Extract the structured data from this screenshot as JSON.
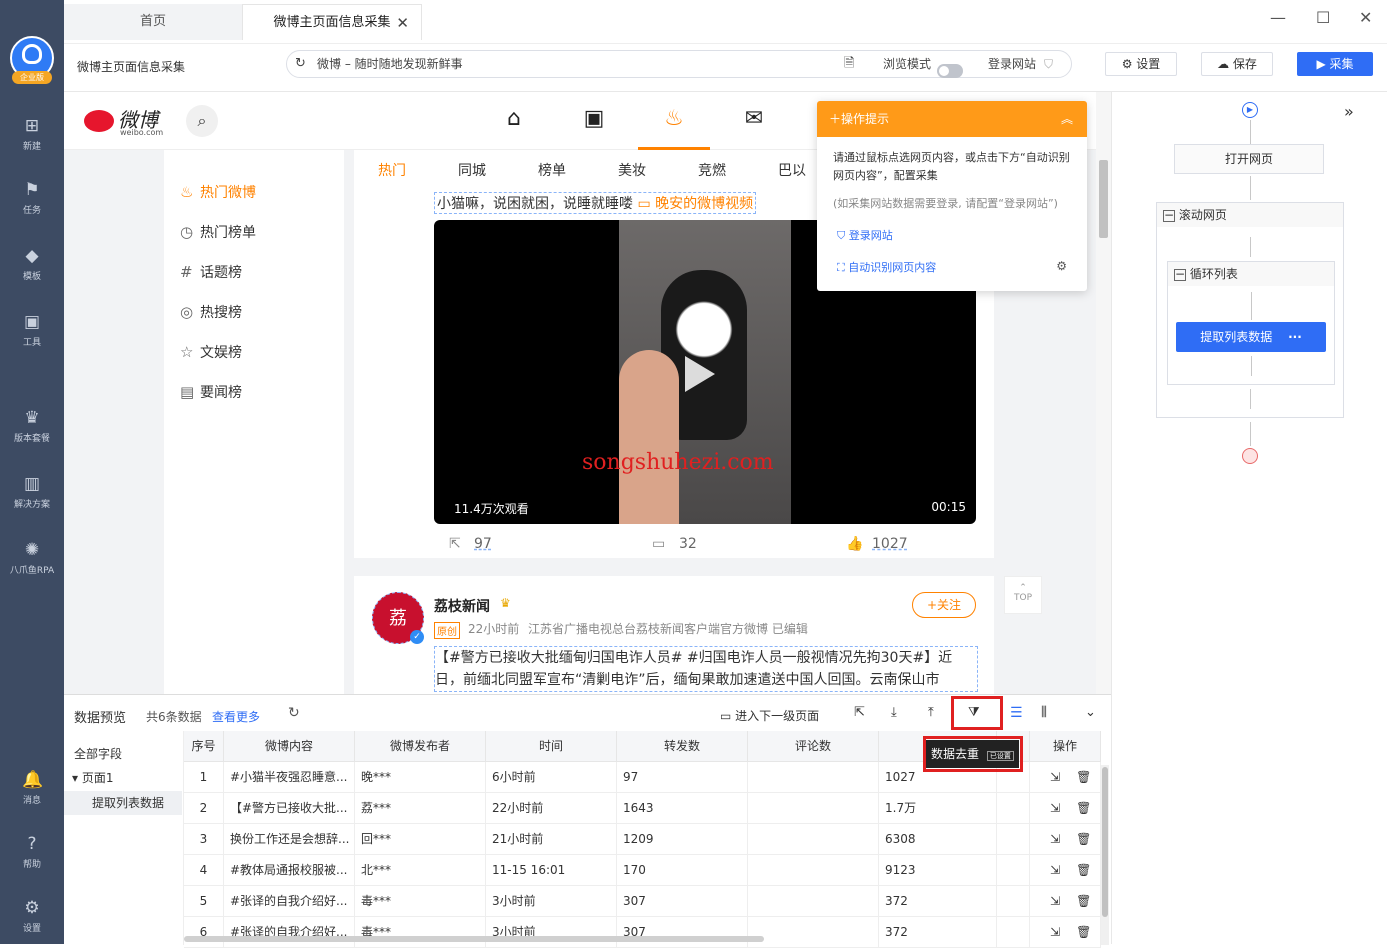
{
  "sidebar": {
    "logo_badge": "企业版",
    "items": [
      {
        "icon": "plus-square-icon",
        "glyph": "⊞",
        "label": "新建"
      },
      {
        "icon": "task-icon",
        "glyph": "⚑",
        "label": "任务"
      },
      {
        "icon": "template-icon",
        "glyph": "◆",
        "label": "模板"
      },
      {
        "icon": "toolbox-icon",
        "glyph": "▣",
        "label": "工具"
      },
      {
        "icon": "crown-icon",
        "glyph": "♛",
        "label": "版本套餐"
      },
      {
        "icon": "solution-icon",
        "glyph": "▥",
        "label": "解决方案"
      },
      {
        "icon": "octopus-icon",
        "glyph": "✺",
        "label": "八爪鱼RPA"
      }
    ],
    "bottom_items": [
      {
        "icon": "bell-icon",
        "glyph": "🔔",
        "label": "消息"
      },
      {
        "icon": "help-icon",
        "glyph": "?",
        "label": "帮助"
      },
      {
        "icon": "settings-gear-icon",
        "glyph": "⚙",
        "label": "设置"
      }
    ]
  },
  "tabs": {
    "home": "首页",
    "active": "微博主页面信息采集"
  },
  "addrbar": {
    "task_name": "微博主页面信息采集",
    "url": "微博 – 随时随地发现新鲜事",
    "browse_mode": "浏览模式",
    "login_site": "登录网站",
    "settings": "设置",
    "save": "保存",
    "collect": "采集"
  },
  "weibo": {
    "logo_text": "微博",
    "logo_sub": "weibo.com",
    "left_nav": [
      {
        "icon": "fire-icon",
        "glyph": "♨",
        "label": "热门微博",
        "active": true
      },
      {
        "icon": "clock-icon",
        "glyph": "◷",
        "label": "热门榜单",
        "active": false
      },
      {
        "icon": "hashtag-icon",
        "glyph": "#",
        "label": "话题榜",
        "active": false
      },
      {
        "icon": "search-circle-icon",
        "glyph": "◎",
        "label": "热搜榜",
        "active": false
      },
      {
        "icon": "star-icon",
        "glyph": "☆",
        "label": "文娱榜",
        "active": false
      },
      {
        "icon": "news-icon",
        "glyph": "▤",
        "label": "要闻榜",
        "active": false
      }
    ],
    "feed_tabs": [
      "热门",
      "同城",
      "榜单",
      "美妆",
      "竞燃",
      "巴以"
    ],
    "post1": {
      "text": "小猫嘛，说困就困，说睡就睡喽",
      "link": "晚安的微博视频",
      "views": "11.4万次观看",
      "duration": "00:15",
      "watermark": "songshuhezi.com",
      "reposts": "97",
      "comments": "32",
      "likes": "1027"
    },
    "post2": {
      "author": "荔枝新闻",
      "follow": "+关注",
      "tag": "原创",
      "time": "22小时前",
      "source": "江苏省广播电视总台荔枝新闻客户端官方微博 已编辑",
      "text": "【#警方已接收大批缅甸归国电诈人员# #归国电诈人员一般视情况先拘30天#】近日，前缅北同盟军宣布“清剿电诈”后，缅甸果敢加速遣送中国人回国。云南保山市"
    },
    "top_label": "TOP"
  },
  "tip": {
    "title": "操作提示",
    "body": "请通过鼠标点选网页内容，或点击下方“自动识别网页内容”，配置采集",
    "note": "(如采集网站数据需要登录, 请配置“登录网站”)",
    "link1": "登录网站",
    "link2": "自动识别网页内容"
  },
  "flow": {
    "open_page": "打开网页",
    "scroll": "滚动网页",
    "loop": "循环列表",
    "extract": "提取列表数据"
  },
  "preview": {
    "title": "数据预览",
    "count": "共6条数据",
    "more": "查看更多",
    "next_level": "进入下一级页面",
    "dedup": "数据去重",
    "dedup_badge": "已设置",
    "all_fields": "全部字段",
    "page1": "页面1",
    "extract": "提取列表数据",
    "columns": [
      "序号",
      "微博内容",
      "微博发布者",
      "时间",
      "转发数",
      "评论数",
      "",
      "",
      "操作"
    ],
    "rows": [
      [
        "1",
        "#小猫半夜强忍睡意...",
        "晚***",
        "6小时前",
        "97",
        "",
        "1027"
      ],
      [
        "2",
        "【#警方已接收大批...",
        "荔***",
        "22小时前",
        "1643",
        "",
        "1.7万"
      ],
      [
        "3",
        "换份工作还是会想辞...",
        "回***",
        "21小时前",
        "1209",
        "",
        "6308"
      ],
      [
        "4",
        "#教体局通报校服被...",
        "北***",
        "11-15 16:01",
        "170",
        "",
        "9123"
      ],
      [
        "5",
        "#张译的自我介绍好...",
        "毒***",
        "3小时前",
        "307",
        "",
        "372"
      ],
      [
        "6",
        "#张译的自我介绍好...",
        "毒***",
        "3小时前",
        "307",
        "",
        "372"
      ]
    ]
  },
  "colors": {
    "accent_orange": "#ff8200",
    "primary_blue": "#2f6df5",
    "sidebar_bg": "#3d4b63",
    "highlight_red": "#e02020"
  }
}
